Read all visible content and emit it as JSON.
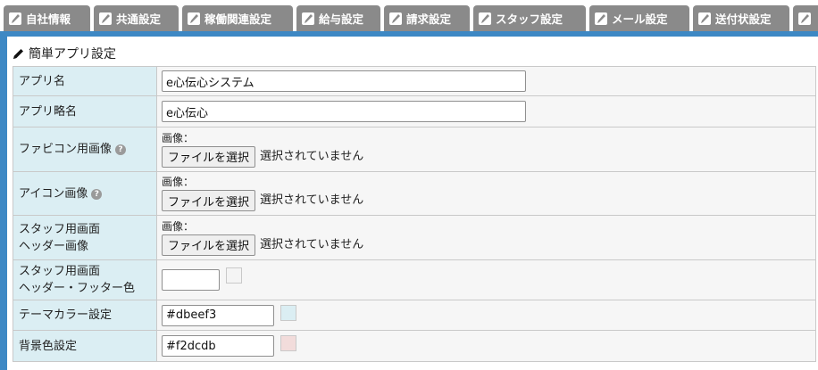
{
  "tabs": [
    {
      "label": "自社情報",
      "icon": "edit-icon"
    },
    {
      "label": "共通設定",
      "icon": "edit-icon"
    },
    {
      "label": "稼働関連設定",
      "icon": "edit-icon"
    },
    {
      "label": "給与設定",
      "icon": "edit-icon"
    },
    {
      "label": "請求設定",
      "icon": "edit-icon"
    },
    {
      "label": "スタッフ設定",
      "icon": "edit-icon"
    },
    {
      "label": "メール設定",
      "icon": "edit-icon"
    },
    {
      "label": "送付状設定",
      "icon": "edit-icon"
    },
    {
      "label": "",
      "icon": "edit-icon"
    }
  ],
  "section": {
    "title": "簡単アプリ設定",
    "icon": "pencil-icon"
  },
  "rows": {
    "app_name": {
      "label": "アプリ名",
      "value": "e心伝心システム"
    },
    "app_short_name": {
      "label": "アプリ略名",
      "value": "e心伝心"
    },
    "favicon": {
      "label": "ファビコン用画像",
      "caption": "画像：",
      "button": "ファイルを選択",
      "status": "選択されていません"
    },
    "icon_image": {
      "label": "アイコン画像",
      "caption": "画像：",
      "button": "ファイルを選択",
      "status": "選択されていません"
    },
    "staff_header": {
      "label_line1": "スタッフ用画面",
      "label_line2": "ヘッダー画像",
      "caption": "画像：",
      "button": "ファイルを選択",
      "status": "選択されていません"
    },
    "staff_color": {
      "label_line1": "スタッフ用画面",
      "label_line2": "ヘッダー・フッター色",
      "value": "",
      "swatch_color": "#f4f4f4"
    },
    "theme_color": {
      "label": "テーマカラー設定",
      "value": "#dbeef3",
      "swatch_color": "#dbeef3"
    },
    "bg_color": {
      "label": "背景色設定",
      "value": "#f2dcdb",
      "swatch_color": "#f2dcdb"
    }
  },
  "colors": {
    "tab_bg": "#8a8a8a",
    "frame": "#3d88c4",
    "label_bg": "#dbeef3",
    "value_bg": "#f6f6f6"
  }
}
